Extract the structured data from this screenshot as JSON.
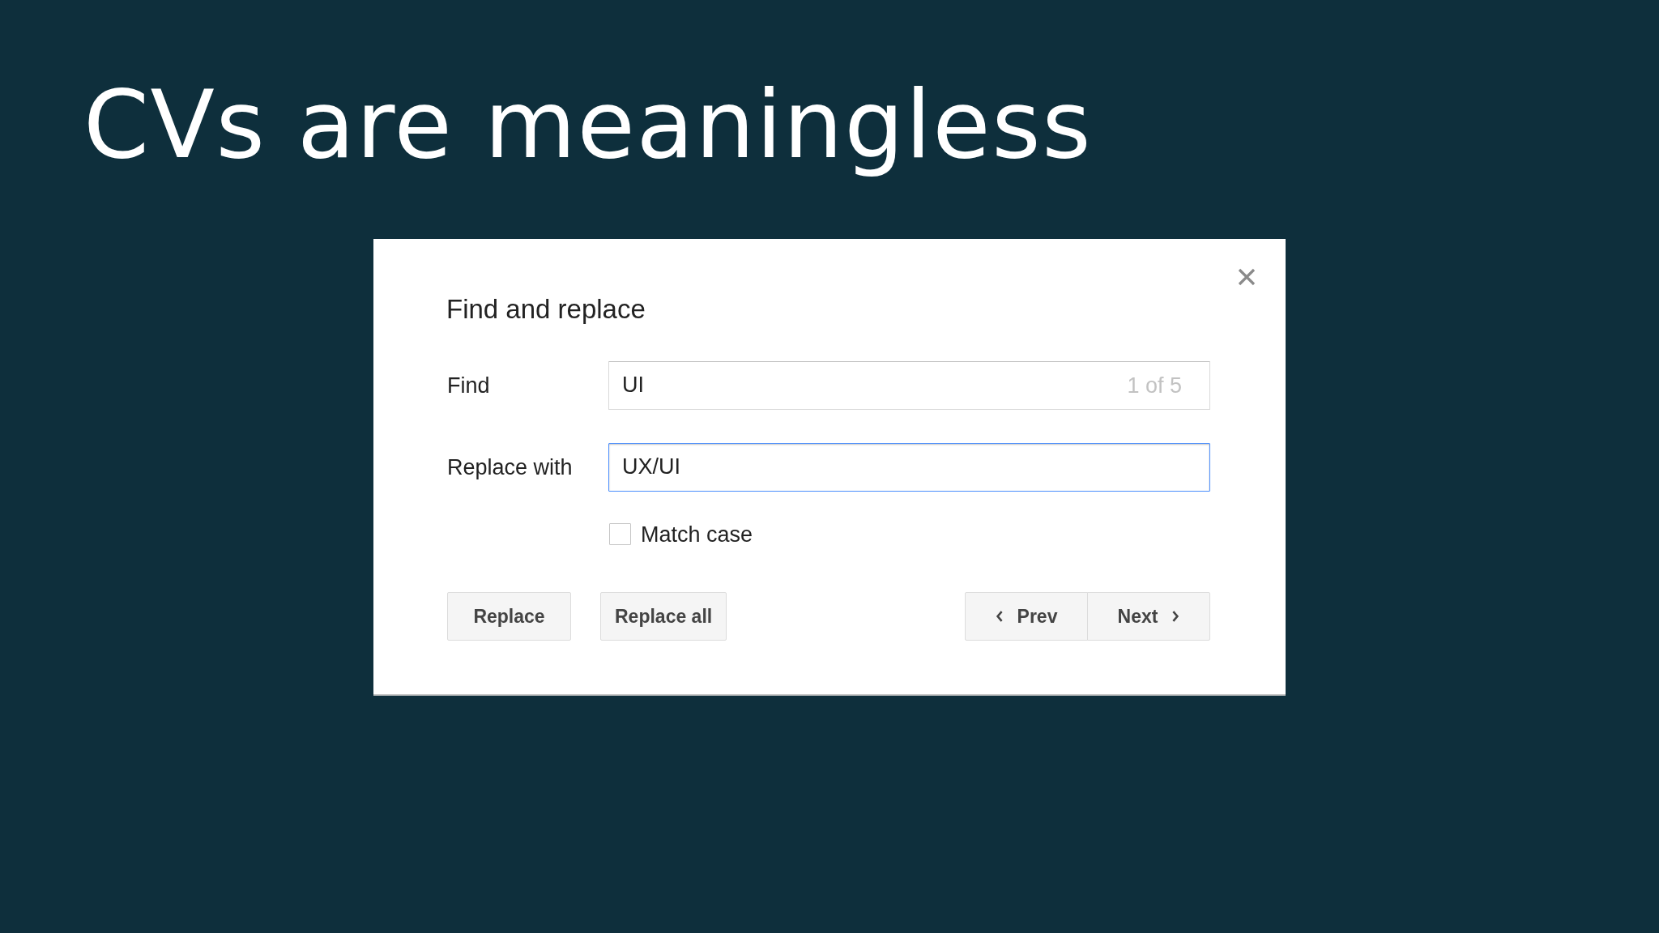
{
  "slide": {
    "title": "CVs are meaningless"
  },
  "dialog": {
    "title": "Find and replace",
    "fields": [
      {
        "label": "Find",
        "value": "UI",
        "match_count": "1 of 5",
        "focused": false
      },
      {
        "label": "Replace with",
        "value": "UX/UI",
        "focused": true
      }
    ],
    "match_case": {
      "label": "Match case",
      "checked": false
    },
    "actions": [
      {
        "label": "Replace"
      },
      {
        "label": "Replace all"
      }
    ],
    "navigation": [
      {
        "kind": "prev",
        "label": "Prev"
      },
      {
        "kind": "next",
        "label": "Next"
      }
    ]
  }
}
